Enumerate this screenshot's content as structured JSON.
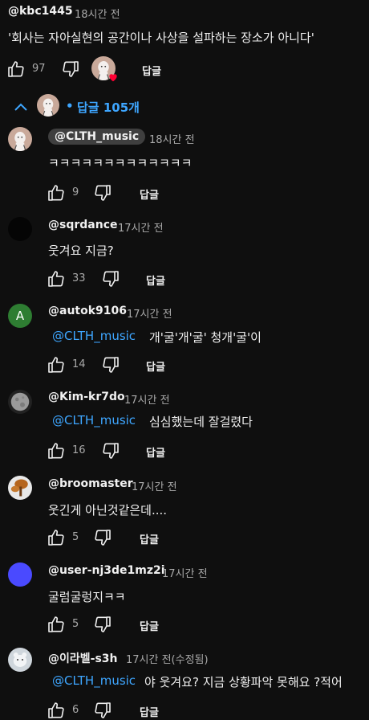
{
  "top_comment": {
    "author": "@kbc1445",
    "time": "18시간 전",
    "text": "'회사는 자아실현의 공간이나 사상을 설파하는 장소가 아니다'",
    "likes": "97",
    "reply_label": "답글"
  },
  "replies_toggle": {
    "bullet": "•",
    "label": "답글 105개"
  },
  "replies": [
    {
      "author": "@CLTH_music",
      "time": "18시간 전",
      "mention": "",
      "text": "ㅋㅋㅋㅋㅋㅋㅋㅋㅋㅋㅋㅋㅋ",
      "likes": "9",
      "reply_label": "답글"
    },
    {
      "author": "@sqrdance",
      "time": "17시간 전",
      "mention": "",
      "text": "웃겨요 지금?",
      "likes": "33",
      "reply_label": "답글"
    },
    {
      "author": "@autok9106",
      "time": "17시간 전",
      "mention": "@CLTH_music",
      "text": "개'굴'개'굴' 청개'굴'이",
      "likes": "14",
      "reply_label": "답글",
      "avatar_letter": "A"
    },
    {
      "author": "@Kim-kr7do",
      "time": "17시간 전",
      "mention": "@CLTH_music",
      "text": "심심했는데 잘걸렸다",
      "likes": "16",
      "reply_label": "답글"
    },
    {
      "author": "@broomaster",
      "time": "17시간 전",
      "mention": "",
      "text": "웃긴게 아닌것같은데....",
      "likes": "5",
      "reply_label": "답글"
    },
    {
      "author": "@user-nj3de1mz2i",
      "time": "17시간 전",
      "mention": "",
      "text": "굴럼굴렁지ㅋㅋ",
      "likes": "5",
      "reply_label": "답글"
    },
    {
      "author": "@이라벨-s3h",
      "time": "17시간 전(수정됨)",
      "mention": "@CLTH_music",
      "text": "야 웃겨요? 지금 상황파악 못해요 ?적어",
      "likes": "6",
      "reply_label": "답글"
    }
  ],
  "colors": {
    "background": "#0f0f0f",
    "link": "#3ea6ff",
    "secondary_text": "#aaaaaa",
    "heart": "#ff0033",
    "chip": "#3f3f3f"
  },
  "icons": [
    "thumbs-up-icon",
    "thumbs-down-icon",
    "chevron-up-icon",
    "heart-icon"
  ]
}
